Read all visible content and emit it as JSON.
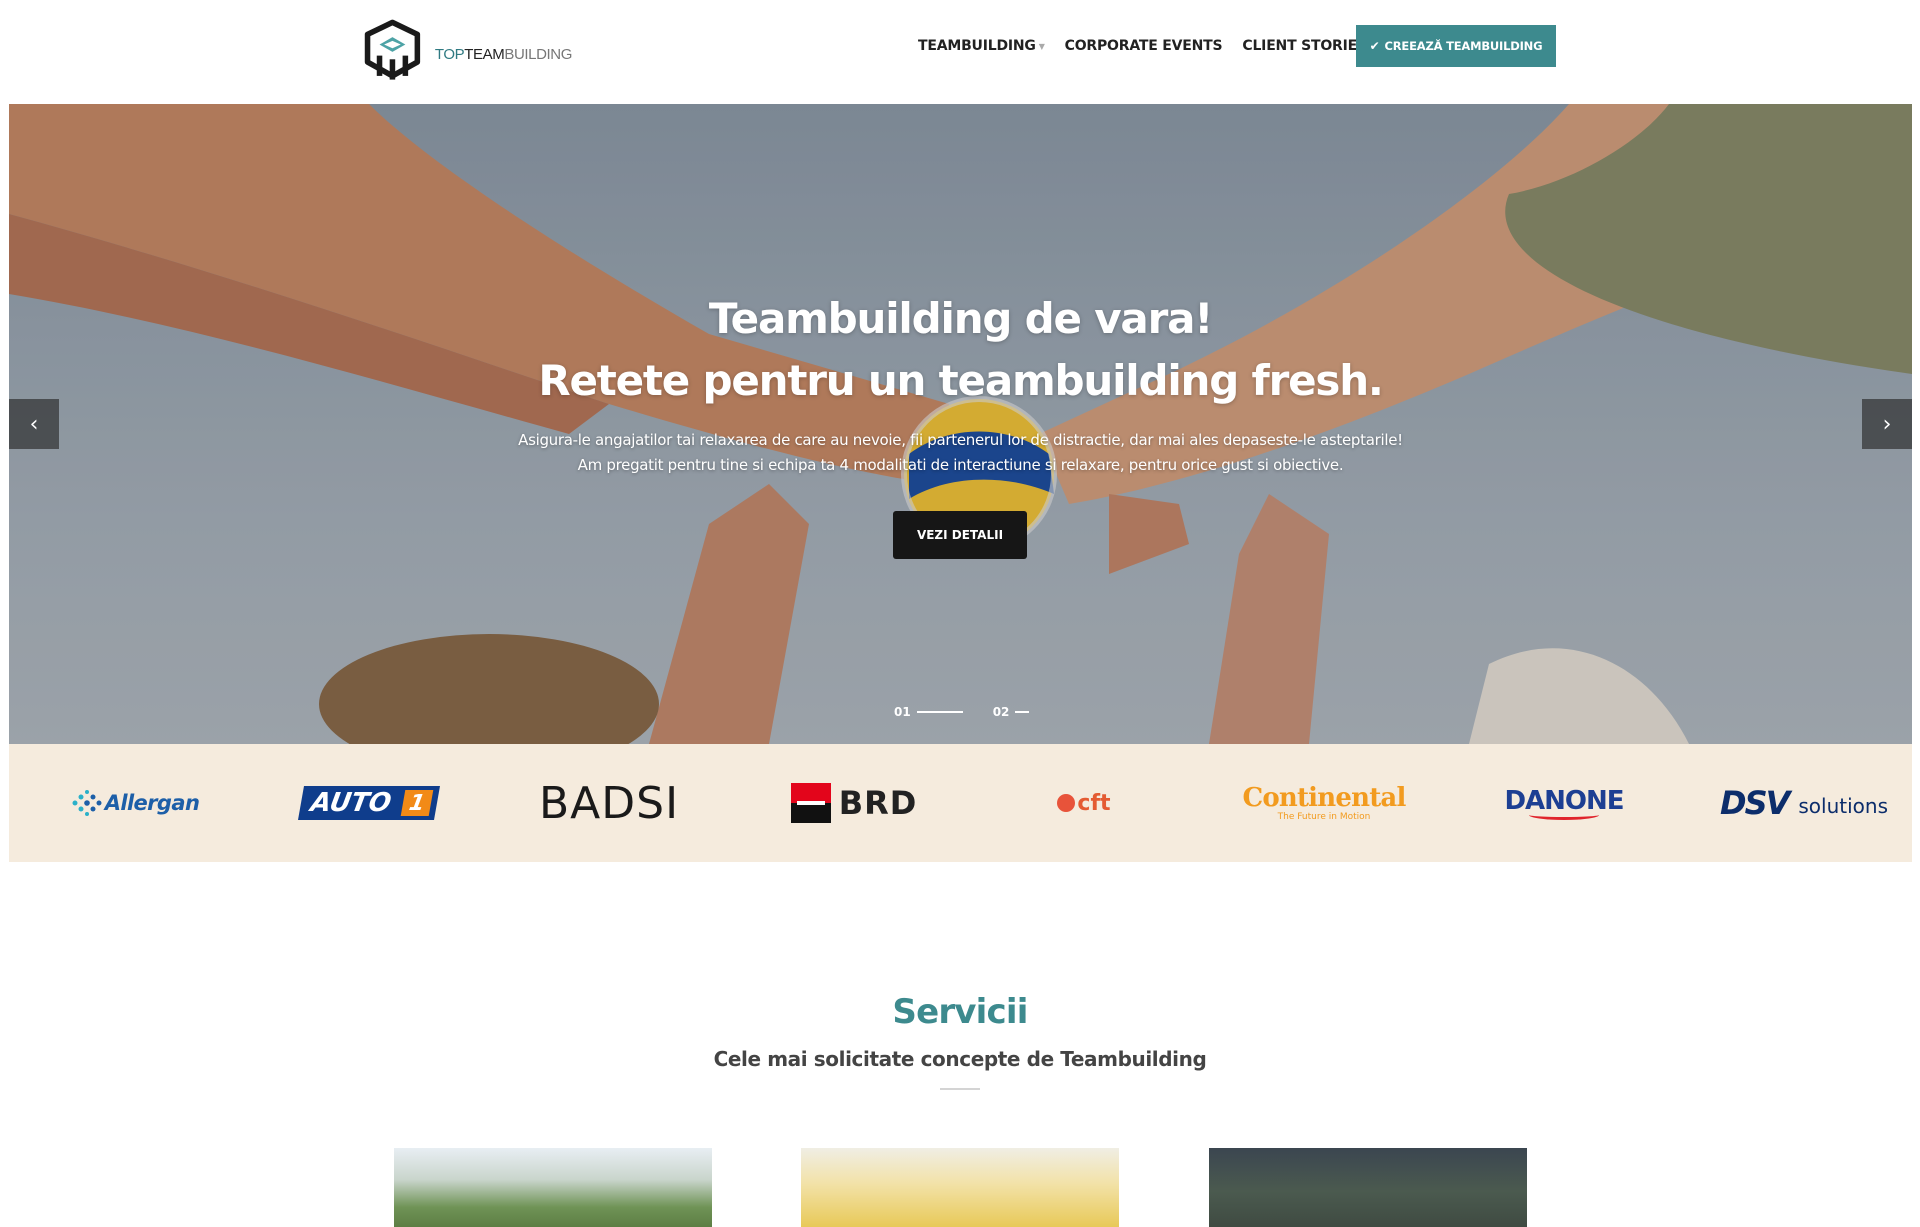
{
  "header": {
    "logo": {
      "text_1": "TOP",
      "text_2": "TEAM",
      "text_3": "BUILDING"
    },
    "nav": [
      {
        "label": "TEAMBUILDING",
        "has_dropdown": true
      },
      {
        "label": "CORPORATE EVENTS",
        "has_dropdown": false
      },
      {
        "label": "CLIENT STORIES",
        "has_dropdown": false
      }
    ],
    "cta_label": "CREEAZĂ TEAMBUILDING"
  },
  "hero": {
    "title_line_1": "Teambuilding de vara!",
    "title_line_2": "Retete pentru un teambuilding fresh.",
    "subtitle_line_1": "Asigura-le angajatilor tai relaxarea de care au nevoie, fii partenerul lor de distractie, dar mai ales depaseste-le asteptarile!",
    "subtitle_line_2": "Am pregatit pentru tine si echipa ta 4 modalitati de interactiune si relaxare, pentru orice gust si obiective.",
    "button_label": "VEZI DETALII",
    "slides": [
      {
        "number": "01",
        "active": true
      },
      {
        "number": "02",
        "active": false
      }
    ]
  },
  "clients": {
    "allergan": "Allergan",
    "auto1": "AUTO",
    "auto1_num": "1",
    "badsi": "BADSI",
    "brd": "BRD",
    "cft": "cft",
    "continental": "Continental",
    "continental_tag": "The Future in Motion",
    "danone": "DANONE",
    "dsv": "DSV",
    "dsv_sub": "solutions"
  },
  "services": {
    "title": "Servicii",
    "subtitle": "Cele mai solicitate concepte de Teambuilding"
  },
  "colors": {
    "accent": "#3d8a8e",
    "client_band": "#f5ebdd",
    "hero_button": "#161616"
  }
}
